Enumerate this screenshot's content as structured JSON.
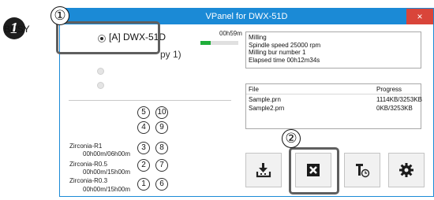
{
  "step_marker": "1",
  "window": {
    "title": "VPanel for DWX-51D",
    "close_glyph": "×"
  },
  "machine": {
    "busy_label": "BUSY",
    "name": "[A] DWX-51D",
    "partial_text": "py 1)",
    "elapsed_short": "00h59m",
    "progress": 0.28
  },
  "status": {
    "lines": [
      "Milling",
      "Spindle speed 25000 rpm",
      "Milling bur number 1",
      "Elapsed time 00h12m34s"
    ]
  },
  "queue": {
    "headers": {
      "file": "File",
      "progress": "Progress"
    },
    "rows": [
      {
        "file": "Sample.prn",
        "progress": "1114KB/3253KB"
      },
      {
        "file": "Sample2.prn",
        "progress": "0KB/3253KB"
      }
    ]
  },
  "slots": {
    "left": [
      "5",
      "4",
      "3",
      "2",
      "1"
    ],
    "right": [
      "10",
      "9",
      "8",
      "7",
      "6"
    ]
  },
  "discs": [
    {
      "name": "Zirconia-R1",
      "time": "00h00m/06h00m"
    },
    {
      "name": "Zirconia-R0.5",
      "time": "00h00m/15h00m"
    },
    {
      "name": "Zirconia-R0.3",
      "time": "00h00m/15h00m"
    }
  ],
  "callouts": {
    "one": "①",
    "two": "②"
  },
  "toolbar": {
    "icons": [
      "output-icon",
      "stop-icon",
      "tool-timer-icon",
      "settings-icon"
    ]
  }
}
